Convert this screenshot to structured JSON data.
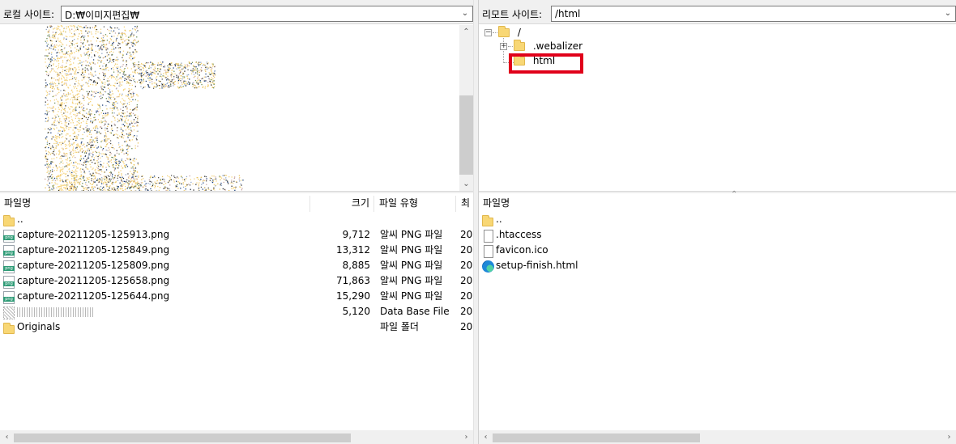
{
  "local": {
    "address_label": "로컬 사이트:",
    "address_value": "D:₩이미지편집₩",
    "list": {
      "headers": {
        "name": "파일명",
        "size": "크기",
        "type": "파일 유형",
        "modified": "최"
      },
      "rows": [
        {
          "name": "..",
          "icon": "folder-icon",
          "size": "",
          "type": "",
          "modified": ""
        },
        {
          "name": "capture-20211205-125913.png",
          "icon": "png-file-icon",
          "size": "9,712",
          "type": "알씨 PNG 파일",
          "modified": "20"
        },
        {
          "name": "capture-20211205-125849.png",
          "icon": "png-file-icon",
          "size": "13,312",
          "type": "알씨 PNG 파일",
          "modified": "20"
        },
        {
          "name": "capture-20211205-125809.png",
          "icon": "png-file-icon",
          "size": "8,885",
          "type": "알씨 PNG 파일",
          "modified": "20"
        },
        {
          "name": "capture-20211205-125658.png",
          "icon": "png-file-icon",
          "size": "71,863",
          "type": "알씨 PNG 파일",
          "modified": "20"
        },
        {
          "name": "capture-20211205-125644.png",
          "icon": "png-file-icon",
          "size": "15,290",
          "type": "알씨 PNG 파일",
          "modified": "20"
        },
        {
          "name": "",
          "icon": "database-file-icon",
          "size": "5,120",
          "type": "Data Base File",
          "modified": "20"
        },
        {
          "name": "Originals",
          "icon": "folder-icon",
          "size": "",
          "type": "파일 폴더",
          "modified": "20"
        }
      ]
    }
  },
  "remote": {
    "address_label": "리모트 사이트:",
    "address_value": "/html",
    "tree": [
      {
        "label": "/",
        "icon": "folder-icon"
      },
      {
        "label": ".webalizer",
        "icon": "folder-icon"
      },
      {
        "label": "html",
        "icon": "folder-icon",
        "highlighted": true
      }
    ],
    "list": {
      "headers": {
        "name": "파일명"
      },
      "rows": [
        {
          "name": "..",
          "icon": "folder-icon"
        },
        {
          "name": ".htaccess",
          "icon": "file-icon"
        },
        {
          "name": "favicon.ico",
          "icon": "file-icon"
        },
        {
          "name": "setup-finish.html",
          "icon": "edge-browser-icon"
        }
      ]
    }
  },
  "colors": {
    "highlight": "#e0001a",
    "folder": "#f8d775",
    "png_badge": "#2f9b77"
  }
}
